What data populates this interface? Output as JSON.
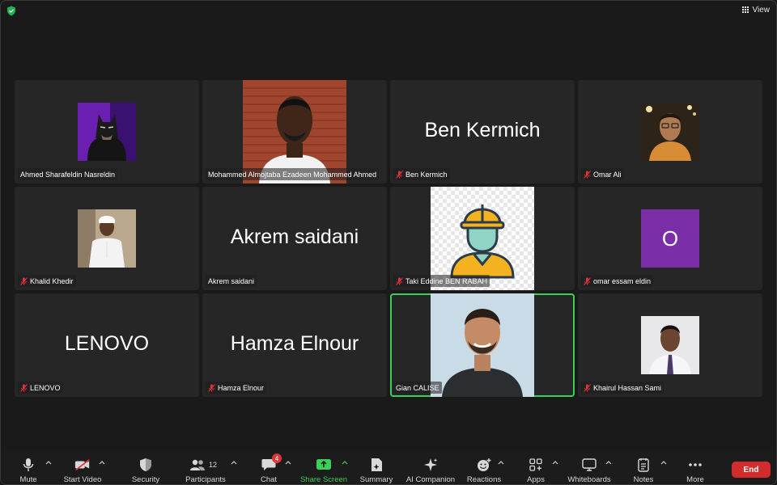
{
  "top_bar": {
    "view_label": "View",
    "icons": [
      "security-shield-icon",
      "grid-view-icon"
    ]
  },
  "tiles": [
    {
      "name": "Ahmed Sharafeldin Nasreldin",
      "display": "photo",
      "photo": "batman avatar",
      "muted": false
    },
    {
      "name": "Mohammed Almojtaba Ezadeen Mohammed Ahmed",
      "display": "video",
      "photo": "man in front of brick wall",
      "muted": false
    },
    {
      "name": "Ben Kermich",
      "display": "name",
      "big_name": "Ben Kermich",
      "muted": true
    },
    {
      "name": "Omar Ali",
      "display": "photo",
      "photo": "man with glasses",
      "muted": true
    },
    {
      "name": "Khalid Khedir",
      "display": "photo",
      "photo": "man in white thobe",
      "muted": true
    },
    {
      "name": "Akrem saidani",
      "display": "name",
      "big_name": "Akrem saidani",
      "muted": false
    },
    {
      "name": "Taki Eddine BEN RABAH",
      "display": "video",
      "photo": "worker helmet avatar",
      "muted": true
    },
    {
      "name": "omar essam eldin",
      "display": "initial",
      "initial": "O",
      "muted": true
    },
    {
      "name": "LENOVO",
      "display": "name",
      "big_name": "LENOVO",
      "muted": true
    },
    {
      "name": "Hamza Elnour",
      "display": "name",
      "big_name": "Hamza Elnour",
      "muted": true
    },
    {
      "name": "Gian CALISE",
      "display": "video",
      "photo": "smiling man",
      "muted": false,
      "active_speaker": true
    },
    {
      "name": "Khairul Hassan Sami",
      "display": "photo",
      "photo": "man in shirt and tie",
      "muted": true
    }
  ],
  "toolbar": {
    "mute": "Mute",
    "start_video": "Start Video",
    "security": "Security",
    "participants": "Participants",
    "participants_count": "12",
    "chat": "Chat",
    "chat_badge": "4",
    "share_screen": "Share Screen",
    "summary": "Summary",
    "ai_companion": "AI Companion",
    "reactions": "Reactions",
    "apps": "Apps",
    "whiteboards": "Whiteboards",
    "notes": "Notes",
    "more": "More",
    "end": "End"
  },
  "colors": {
    "background": "#1a1a1a",
    "tile": "#262626",
    "active_speaker": "#3ccf55",
    "share_green": "#3ccf55",
    "end_red": "#d32c2c",
    "muted_red": "#e0333a",
    "initial_purple": "#7a2ea8"
  }
}
